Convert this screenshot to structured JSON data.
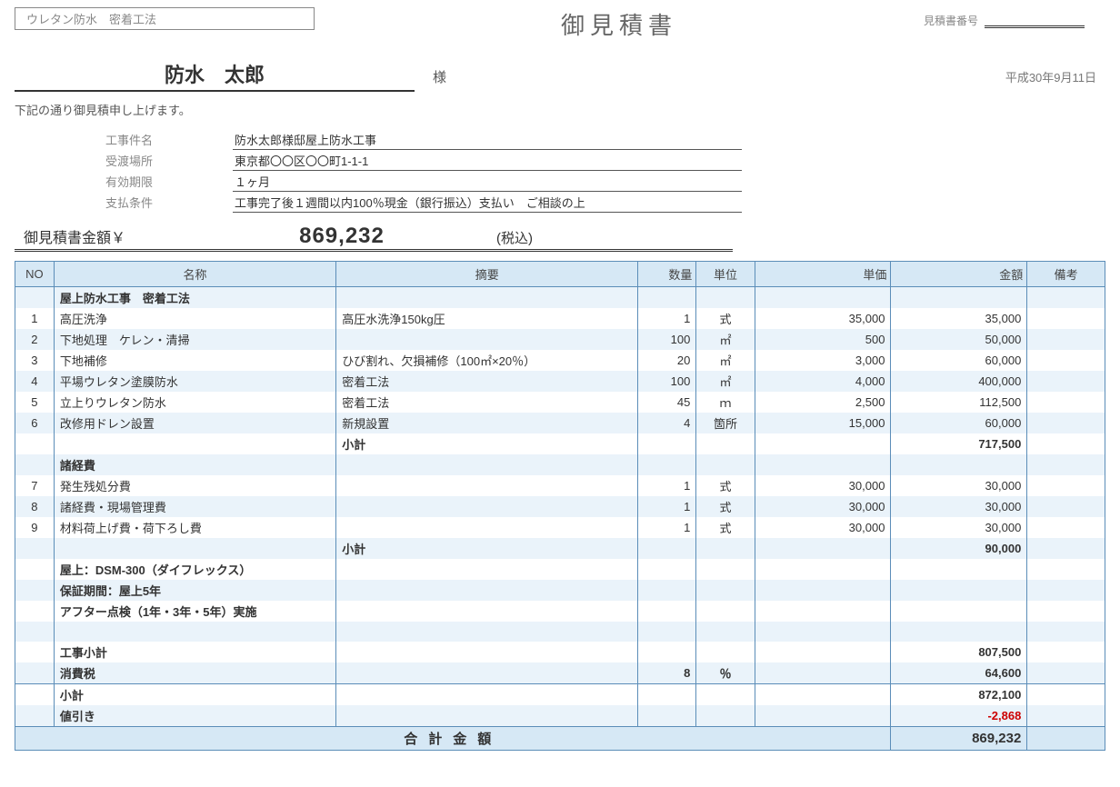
{
  "header": {
    "method": "ウレタン防水　密着工法",
    "title": "御見積書",
    "quote_no_label": "見積書番号",
    "customer": "防水　太郎",
    "sama": "様",
    "date": "平成30年9月11日",
    "intro": "下記の通り御見積申し上げます。"
  },
  "info": {
    "project_label": "工事件名",
    "project": "防水太郎様邸屋上防水工事",
    "location_label": "受渡場所",
    "location": "東京都〇〇区〇〇町1-1-1",
    "validity_label": "有効期限",
    "validity": "１ヶ月",
    "payment_label": "支払条件",
    "payment": "工事完了後１週間以内100％現金（銀行振込）支払い　ご相談の上"
  },
  "amount": {
    "label": "御見積書金額￥",
    "value": "869,232",
    "tax": "(税込)"
  },
  "columns": {
    "no": "NO",
    "name": "名称",
    "desc": "摘要",
    "qty": "数量",
    "unit": "単位",
    "uprice": "単価",
    "amount": "金額",
    "note": "備考"
  },
  "rows": [
    {
      "no": "",
      "name": "屋上防水工事　密着工法",
      "desc": "",
      "qty": "",
      "unit": "",
      "uprice": "",
      "amount": "",
      "bold": true
    },
    {
      "no": "1",
      "name": "高圧洗浄",
      "desc": "高圧水洗浄150kg圧",
      "qty": "1",
      "unit": "式",
      "uprice": "35,000",
      "amount": "35,000"
    },
    {
      "no": "2",
      "name": "下地処理　ケレン・清掃",
      "desc": "",
      "qty": "100",
      "unit": "㎡",
      "uprice": "500",
      "amount": "50,000"
    },
    {
      "no": "3",
      "name": "下地補修",
      "desc": "ひび割れ、欠損補修（100㎡×20％）",
      "qty": "20",
      "unit": "㎡",
      "uprice": "3,000",
      "amount": "60,000"
    },
    {
      "no": "4",
      "name": "平場ウレタン塗膜防水",
      "desc": "密着工法",
      "qty": "100",
      "unit": "㎡",
      "uprice": "4,000",
      "amount": "400,000"
    },
    {
      "no": "5",
      "name": "立上りウレタン防水",
      "desc": "密着工法",
      "qty": "45",
      "unit": "ｍ",
      "uprice": "2,500",
      "amount": "112,500"
    },
    {
      "no": "6",
      "name": "改修用ドレン設置",
      "desc": "新規設置",
      "qty": "4",
      "unit": "箇所",
      "uprice": "15,000",
      "amount": "60,000"
    },
    {
      "no": "",
      "name": "",
      "desc": "小計",
      "qty": "",
      "unit": "",
      "uprice": "",
      "amount": "717,500",
      "bold": true
    },
    {
      "no": "",
      "name": "諸経費",
      "desc": "",
      "qty": "",
      "unit": "",
      "uprice": "",
      "amount": "",
      "bold": true
    },
    {
      "no": "7",
      "name": "発生残処分費",
      "desc": "",
      "qty": "1",
      "unit": "式",
      "uprice": "30,000",
      "amount": "30,000"
    },
    {
      "no": "8",
      "name": "諸経費・現場管理費",
      "desc": "",
      "qty": "1",
      "unit": "式",
      "uprice": "30,000",
      "amount": "30,000"
    },
    {
      "no": "9",
      "name": "材料荷上げ費・荷下ろし費",
      "desc": "",
      "qty": "1",
      "unit": "式",
      "uprice": "30,000",
      "amount": "30,000"
    },
    {
      "no": "",
      "name": "",
      "desc": "小計",
      "qty": "",
      "unit": "",
      "uprice": "",
      "amount": "90,000",
      "bold": true
    },
    {
      "no": "",
      "name": "屋上：DSM-300（ダイフレックス）",
      "desc": "",
      "qty": "",
      "unit": "",
      "uprice": "",
      "amount": "",
      "bold": true
    },
    {
      "no": "",
      "name": "保証期間：屋上5年",
      "desc": "",
      "qty": "",
      "unit": "",
      "uprice": "",
      "amount": "",
      "bold": true
    },
    {
      "no": "",
      "name": "アフター点検（1年・3年・5年）実施",
      "desc": "",
      "qty": "",
      "unit": "",
      "uprice": "",
      "amount": "",
      "bold": true
    },
    {
      "no": "",
      "name": "",
      "desc": "",
      "qty": "",
      "unit": "",
      "uprice": "",
      "amount": ""
    },
    {
      "no": "",
      "name": "工事小計",
      "desc": "",
      "qty": "",
      "unit": "",
      "uprice": "",
      "amount": "807,500",
      "bold": true
    },
    {
      "no": "",
      "name": "消費税",
      "desc": "",
      "qty": "8",
      "unit": "％",
      "uprice": "",
      "amount": "64,600",
      "bold": true,
      "sep": true
    },
    {
      "no": "",
      "name": "小計",
      "desc": "",
      "qty": "",
      "unit": "",
      "uprice": "",
      "amount": "872,100",
      "bold": true
    },
    {
      "no": "",
      "name": "値引き",
      "desc": "",
      "qty": "",
      "unit": "",
      "uprice": "",
      "amount": "-2,868",
      "bold": true,
      "red": true,
      "sep": true
    }
  ],
  "total": {
    "label": "合計金額",
    "value": "869,232"
  }
}
